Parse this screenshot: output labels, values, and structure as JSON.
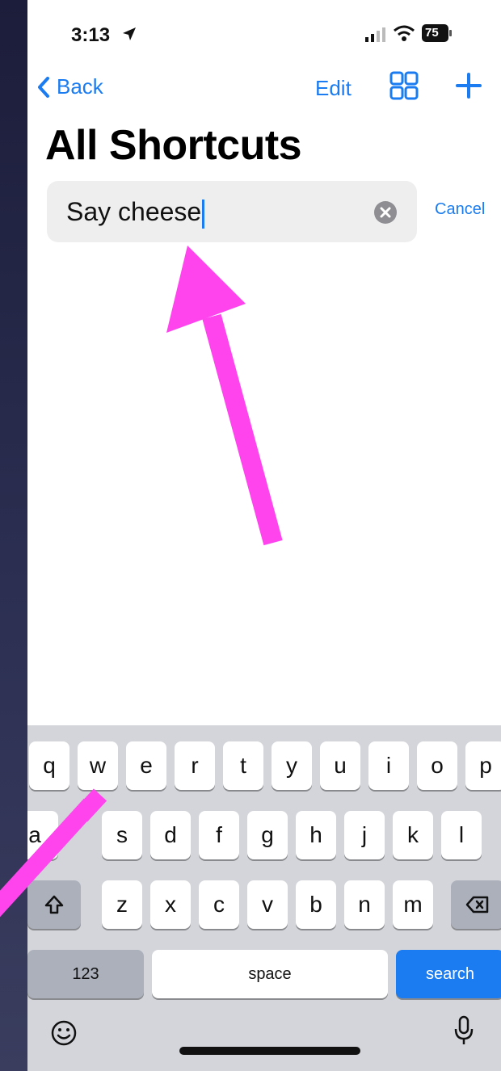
{
  "status_bar": {
    "time": "3:13",
    "battery": "75"
  },
  "nav": {
    "back_label": "Back",
    "edit_label": "Edit"
  },
  "page": {
    "title": "All Shortcuts"
  },
  "search": {
    "value": "Say cheese",
    "cancel_label": "Cancel"
  },
  "keyboard": {
    "row1": [
      "q",
      "w",
      "e",
      "r",
      "t",
      "y",
      "u",
      "i",
      "o",
      "p"
    ],
    "row2": [
      "a",
      "s",
      "d",
      "f",
      "g",
      "h",
      "j",
      "k",
      "l"
    ],
    "row3": [
      "z",
      "x",
      "c",
      "v",
      "b",
      "n",
      "m"
    ],
    "numbers_label": "123",
    "space_label": "space",
    "search_label": "search"
  },
  "colors": {
    "accent": "#1a7cf0",
    "annotation_arrow": "#ff44ee"
  }
}
